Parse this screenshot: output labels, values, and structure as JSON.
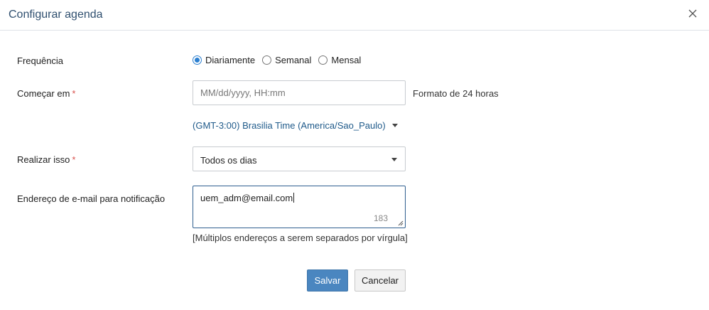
{
  "dialog": {
    "title": "Configurar agenda",
    "close_icon": "close-icon"
  },
  "form": {
    "frequency": {
      "label": "Frequência",
      "options": [
        {
          "label": "Diariamente",
          "checked": true
        },
        {
          "label": "Semanal",
          "checked": false
        },
        {
          "label": "Mensal",
          "checked": false
        }
      ]
    },
    "start": {
      "label": "Começar em",
      "required_mark": "*",
      "placeholder": "MM/dd/yyyy, HH:mm",
      "value": "",
      "hint": "Formato de 24 horas"
    },
    "timezone": {
      "value": "(GMT-3:00) Brasilia Time (America/Sao_Paulo)"
    },
    "perform": {
      "label": "Realizar isso",
      "required_mark": "*",
      "selected": "Todos os dias"
    },
    "email": {
      "label": "Endereço de e-mail para notificação",
      "value": "uem_adm@email.com",
      "remaining_chars": "183",
      "hint": "[Múltiplos endereços a serem separados por vírgula]"
    }
  },
  "buttons": {
    "save": "Salvar",
    "cancel": "Cancelar"
  },
  "colors": {
    "accent": "#4a86c0",
    "title": "#2f4f6f",
    "link": "#1f5a8a",
    "required": "#d9534f"
  }
}
